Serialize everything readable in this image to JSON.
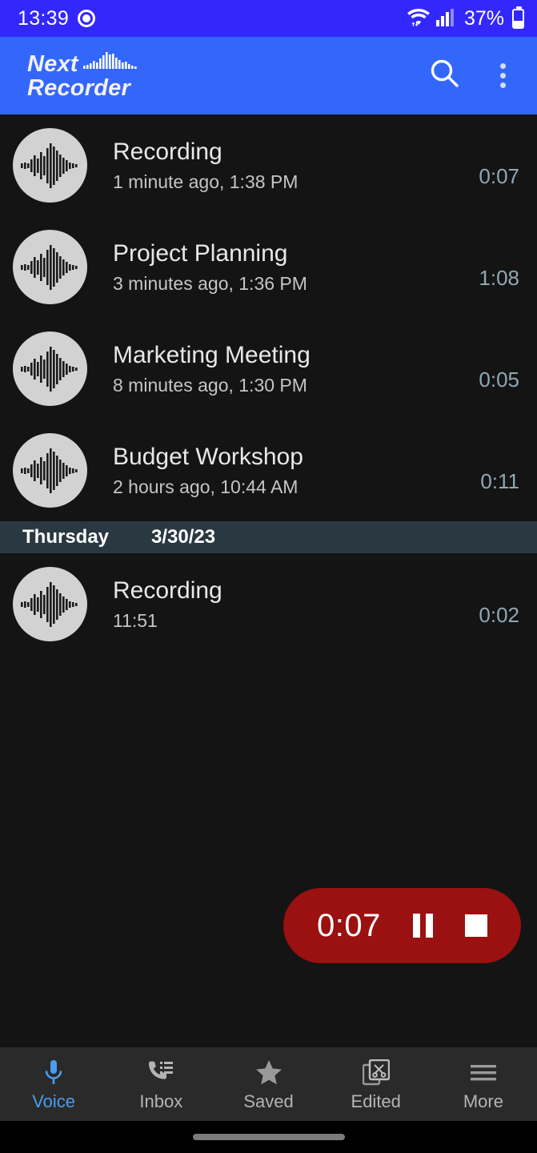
{
  "status_bar": {
    "time": "13:39",
    "recording_indicator": "recording-dot",
    "wifi_icon": "wifi-icon",
    "signal_icon": "signal-bars-icon",
    "battery_percent": "37%",
    "battery_icon": "battery-icon",
    "background_color": "#3328fb"
  },
  "app_bar": {
    "title_line1": "Next",
    "title_line2": "Recorder",
    "waveform_logo": "waveform-logo-icon",
    "search_icon": "search-icon",
    "overflow_icon": "more-vertical-icon",
    "background_color": "#3366fb"
  },
  "recordings": [
    {
      "title": "Recording",
      "subtitle": "1 minute ago, 1:38 PM",
      "duration": "0:07",
      "avatar_icon": "waveform-avatar-icon"
    },
    {
      "title": "Project Planning",
      "subtitle": "3 minutes ago, 1:36 PM",
      "duration": "1:08",
      "avatar_icon": "waveform-avatar-icon"
    },
    {
      "title": "Marketing Meeting",
      "subtitle": "8 minutes ago, 1:30 PM",
      "duration": "0:05",
      "avatar_icon": "waveform-avatar-icon"
    },
    {
      "title": "Budget Workshop",
      "subtitle": "2 hours ago, 10:44 AM",
      "duration": "0:11",
      "avatar_icon": "waveform-avatar-icon"
    }
  ],
  "date_separator": {
    "day": "Thursday",
    "date": "3/30/23",
    "background_color": "#2a3842"
  },
  "recordings_older": [
    {
      "title": "Recording",
      "subtitle": "11:51",
      "duration": "0:02",
      "avatar_icon": "waveform-avatar-icon"
    }
  ],
  "recording_pill": {
    "elapsed": "0:07",
    "pause_icon": "pause-icon",
    "stop_icon": "stop-icon",
    "background_color": "#9b1010"
  },
  "bottom_nav": {
    "active_color": "#4a9df0",
    "items": [
      {
        "label": "Voice",
        "icon": "microphone-icon",
        "active": true
      },
      {
        "label": "Inbox",
        "icon": "phone-list-icon",
        "active": false
      },
      {
        "label": "Saved",
        "icon": "star-icon",
        "active": false
      },
      {
        "label": "Edited",
        "icon": "scissors-docs-icon",
        "active": false
      },
      {
        "label": "More",
        "icon": "hamburger-icon",
        "active": false
      }
    ]
  },
  "gesture_bar": {
    "handle": "home-indicator"
  }
}
